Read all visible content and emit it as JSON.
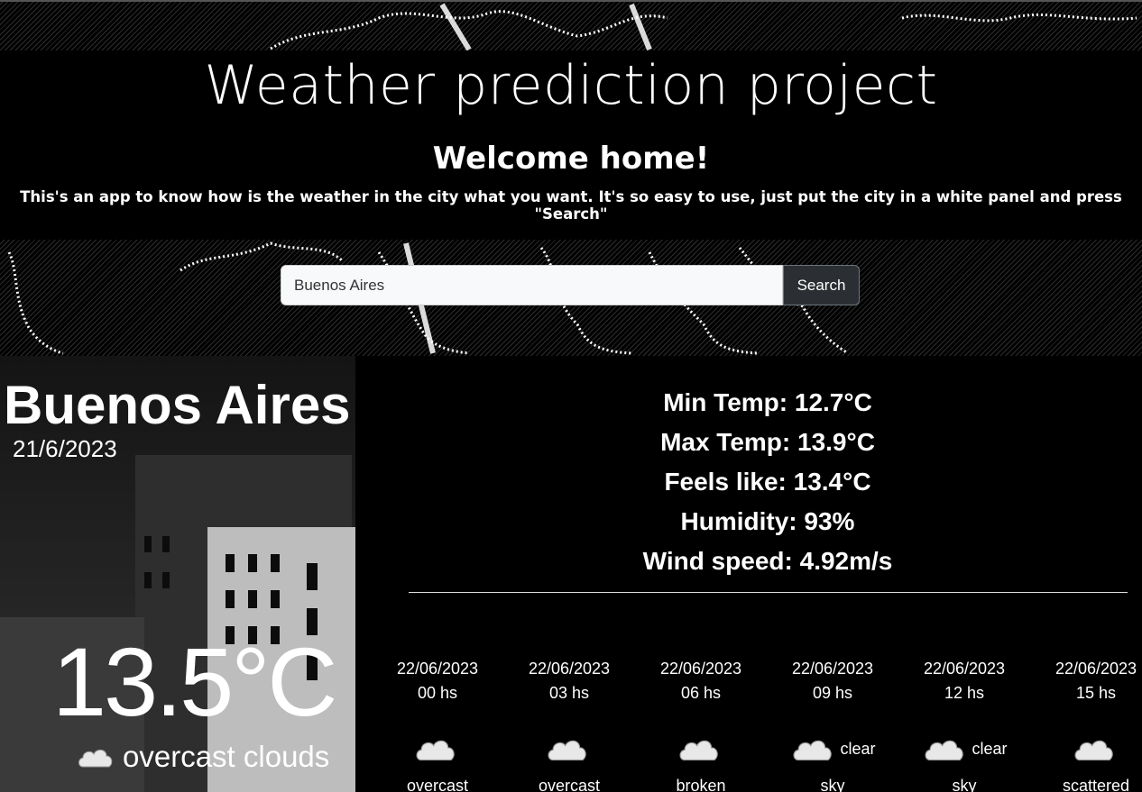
{
  "header": {
    "title": "Weather prediction project",
    "subtitle": "Welcome home!",
    "description": "This's an app to know how is the weather in the city what you want. It's so easy to use, just put the city in a white panel and press \"Search\""
  },
  "search": {
    "value": "Buenos Aires",
    "button_label": "Search"
  },
  "current": {
    "city": "Buenos Aires",
    "date": "21/6/2023",
    "temperature": "13.5°C",
    "condition": "overcast clouds",
    "icon": "cloud-icon"
  },
  "details": {
    "min_temp": "Min Temp: 12.7°C",
    "max_temp": "Max Temp: 13.9°C",
    "feels_like": "Feels like: 13.4°C",
    "humidity": "Humidity: 93%",
    "wind_speed": "Wind speed: 4.92m/s"
  },
  "forecast": [
    {
      "date": "22/06/2023",
      "hour": "00 hs",
      "inline": "",
      "desc": "overcast"
    },
    {
      "date": "22/06/2023",
      "hour": "03 hs",
      "inline": "",
      "desc": "overcast"
    },
    {
      "date": "22/06/2023",
      "hour": "06 hs",
      "inline": "",
      "desc": "broken"
    },
    {
      "date": "22/06/2023",
      "hour": "09 hs",
      "inline": "clear",
      "desc": "sky"
    },
    {
      "date": "22/06/2023",
      "hour": "12 hs",
      "inline": "clear",
      "desc": "sky"
    },
    {
      "date": "22/06/2023",
      "hour": "15 hs",
      "inline": "",
      "desc": "scattered"
    }
  ],
  "colors": {
    "background": "#000000",
    "text": "#ffffff",
    "button": "#2b2f33",
    "input": "#f8f9fa"
  }
}
